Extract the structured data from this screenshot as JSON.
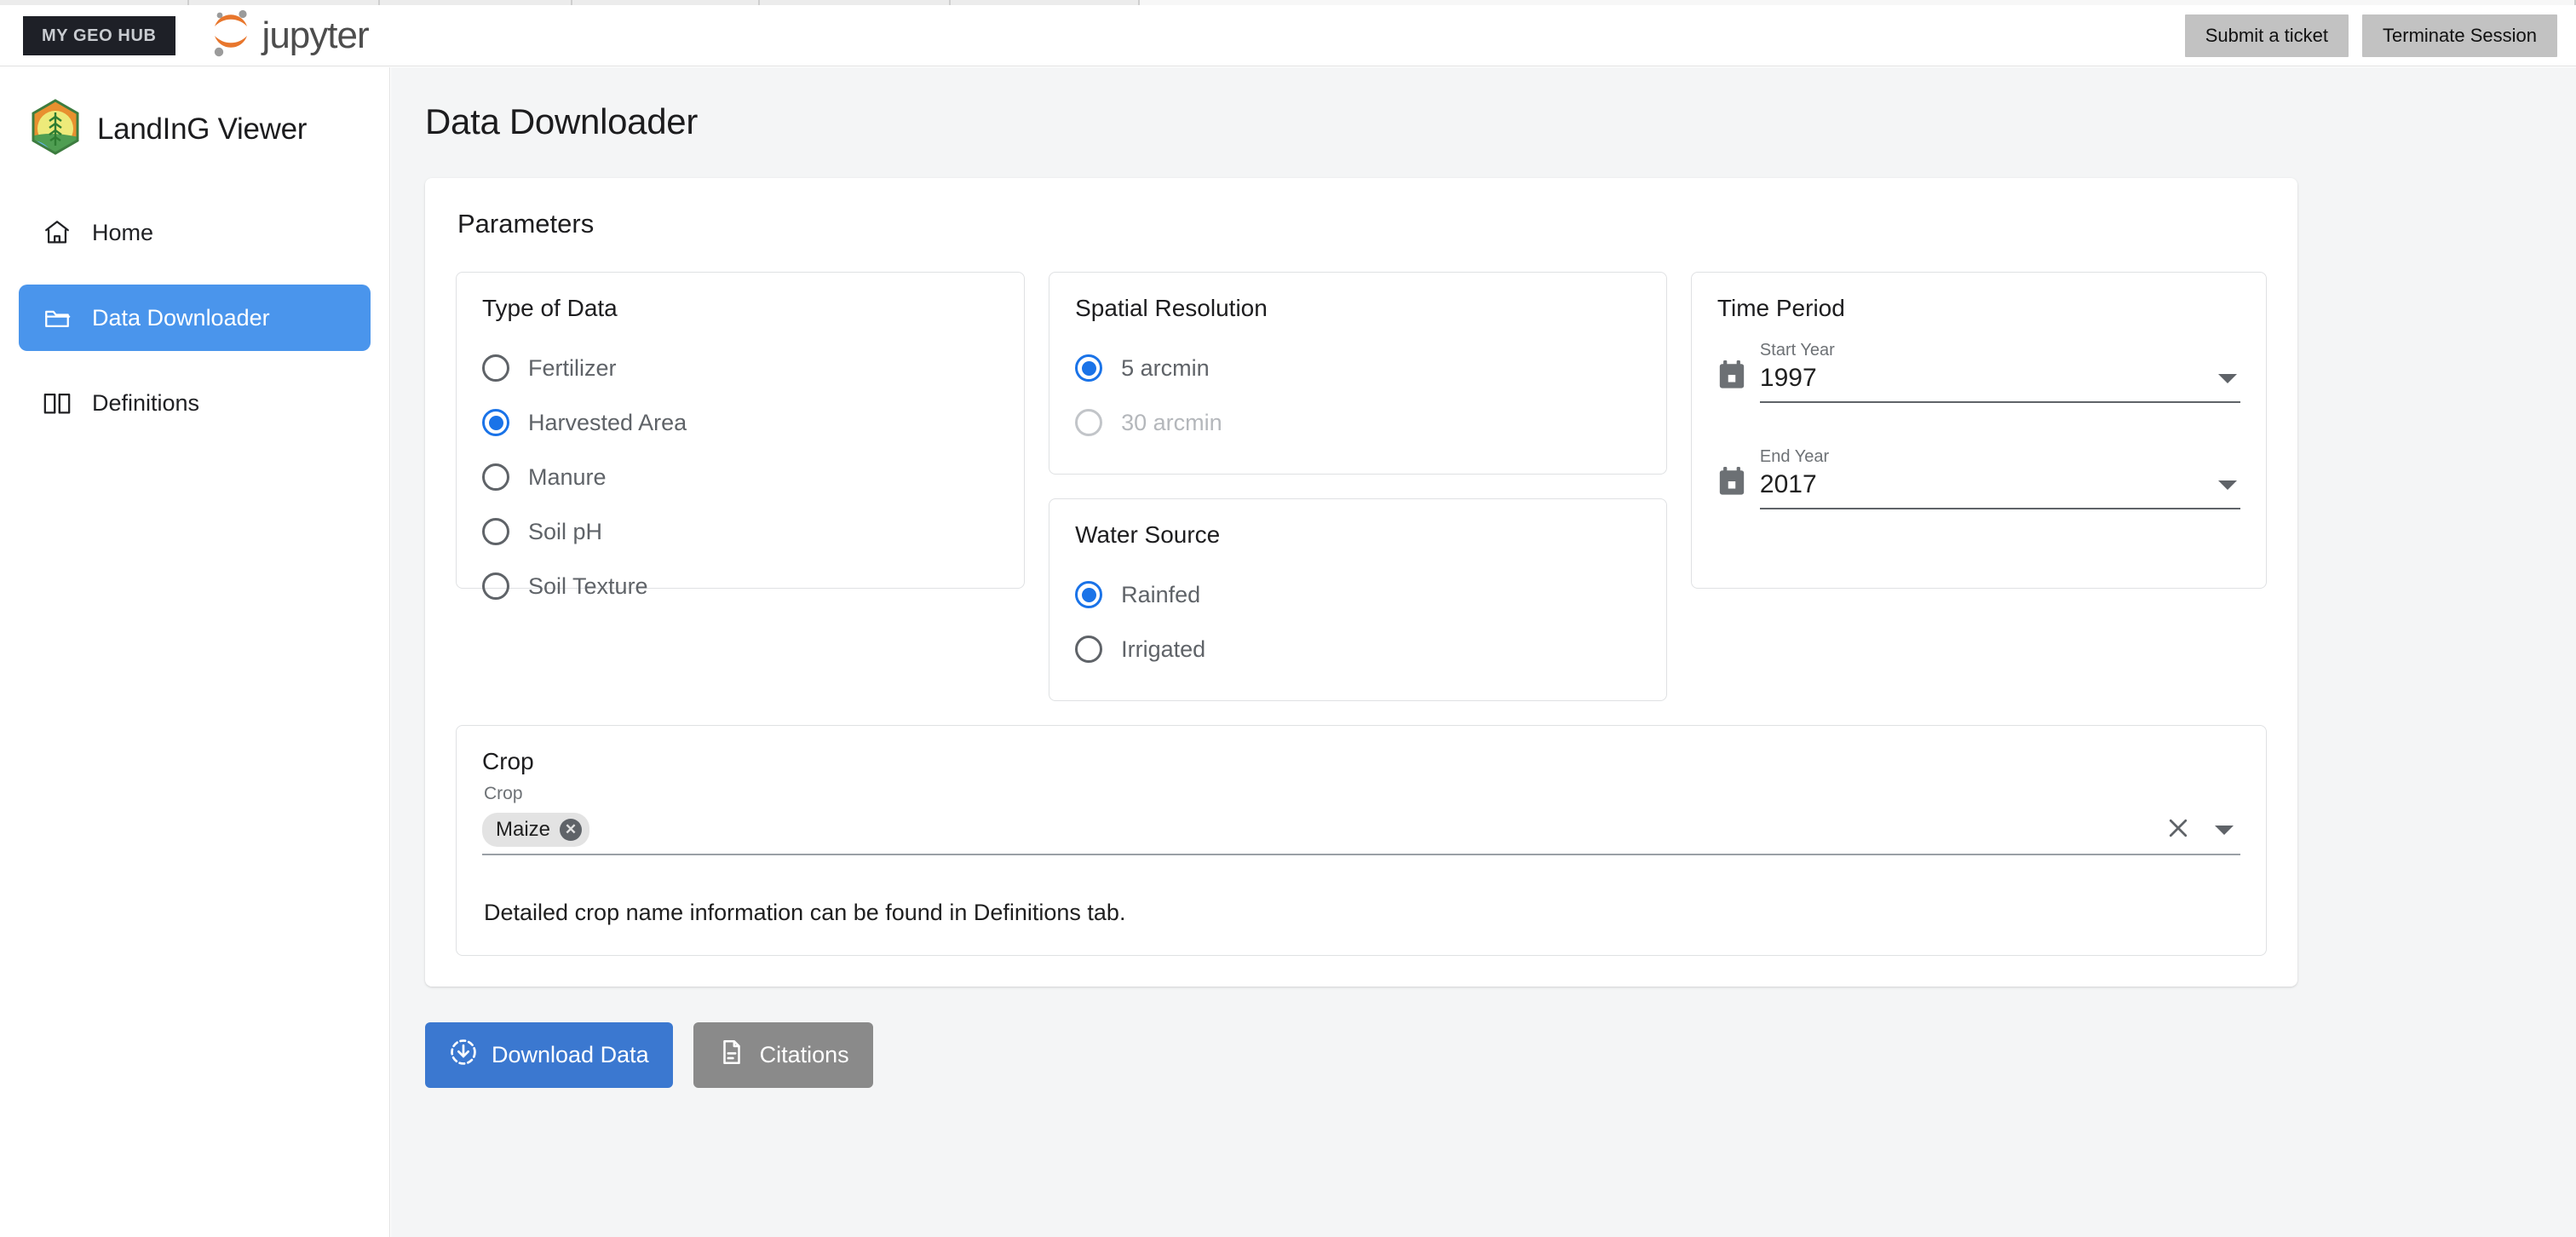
{
  "browser": {
    "tab_count": 7
  },
  "header": {
    "geo_hub_badge": "MY GEO HUB",
    "jupyter_label": "jupyter",
    "jupyter_logo_icon": "jupyter-logo-icon",
    "buttons": [
      {
        "label": "Submit a ticket",
        "name": "submit-ticket-button"
      },
      {
        "label": "Terminate Session",
        "name": "terminate-session-button"
      }
    ]
  },
  "sidebar": {
    "logo_icon": "landing-hexagon-logo-icon",
    "brand": "LandInG Viewer",
    "items": [
      {
        "label": "Home",
        "icon": "home-icon",
        "active": false
      },
      {
        "label": "Data Downloader",
        "icon": "folder-icon",
        "active": true
      },
      {
        "label": "Definitions",
        "icon": "book-icon",
        "active": false
      }
    ]
  },
  "main": {
    "page_title": "Data Downloader",
    "parameters_title": "Parameters",
    "type_of_data": {
      "title": "Type of Data",
      "options": [
        {
          "label": "Fertilizer",
          "selected": false,
          "disabled": false
        },
        {
          "label": "Harvested Area",
          "selected": true,
          "disabled": false
        },
        {
          "label": "Manure",
          "selected": false,
          "disabled": false
        },
        {
          "label": "Soil pH",
          "selected": false,
          "disabled": false
        },
        {
          "label": "Soil Texture",
          "selected": false,
          "disabled": false
        }
      ]
    },
    "spatial_resolution": {
      "title": "Spatial Resolution",
      "options": [
        {
          "label": "5 arcmin",
          "selected": true,
          "disabled": false
        },
        {
          "label": "30 arcmin",
          "selected": false,
          "disabled": true
        }
      ]
    },
    "water_source": {
      "title": "Water Source",
      "options": [
        {
          "label": "Rainfed",
          "selected": true,
          "disabled": false
        },
        {
          "label": "Irrigated",
          "selected": false,
          "disabled": false
        }
      ]
    },
    "time_period": {
      "title": "Time Period",
      "start": {
        "label": "Start Year",
        "value": "1997",
        "icon": "calendar-icon"
      },
      "end": {
        "label": "End Year",
        "value": "2017",
        "icon": "calendar-icon"
      }
    },
    "crop": {
      "title": "Crop",
      "field_label": "Crop",
      "chips": [
        {
          "label": "Maize"
        }
      ],
      "clear_icon": "clear-x-icon",
      "dropdown_icon": "chevron-down-icon",
      "hint": "Detailed crop name information can be found in Definitions tab."
    },
    "actions": [
      {
        "label": "Download Data",
        "icon": "download-circle-icon",
        "name": "download-data-button"
      },
      {
        "label": "Citations",
        "icon": "document-icon",
        "name": "citations-button"
      }
    ]
  },
  "colors": {
    "accent_blue": "#1a73e8",
    "nav_active_blue": "#4a95ec",
    "primary_button_blue": "#3b78d0",
    "secondary_button_gray": "#8a8a8a",
    "badge_dark": "#1e2027",
    "jupyter_orange": "#e8762c",
    "canvas_gray": "#f4f5f6"
  }
}
